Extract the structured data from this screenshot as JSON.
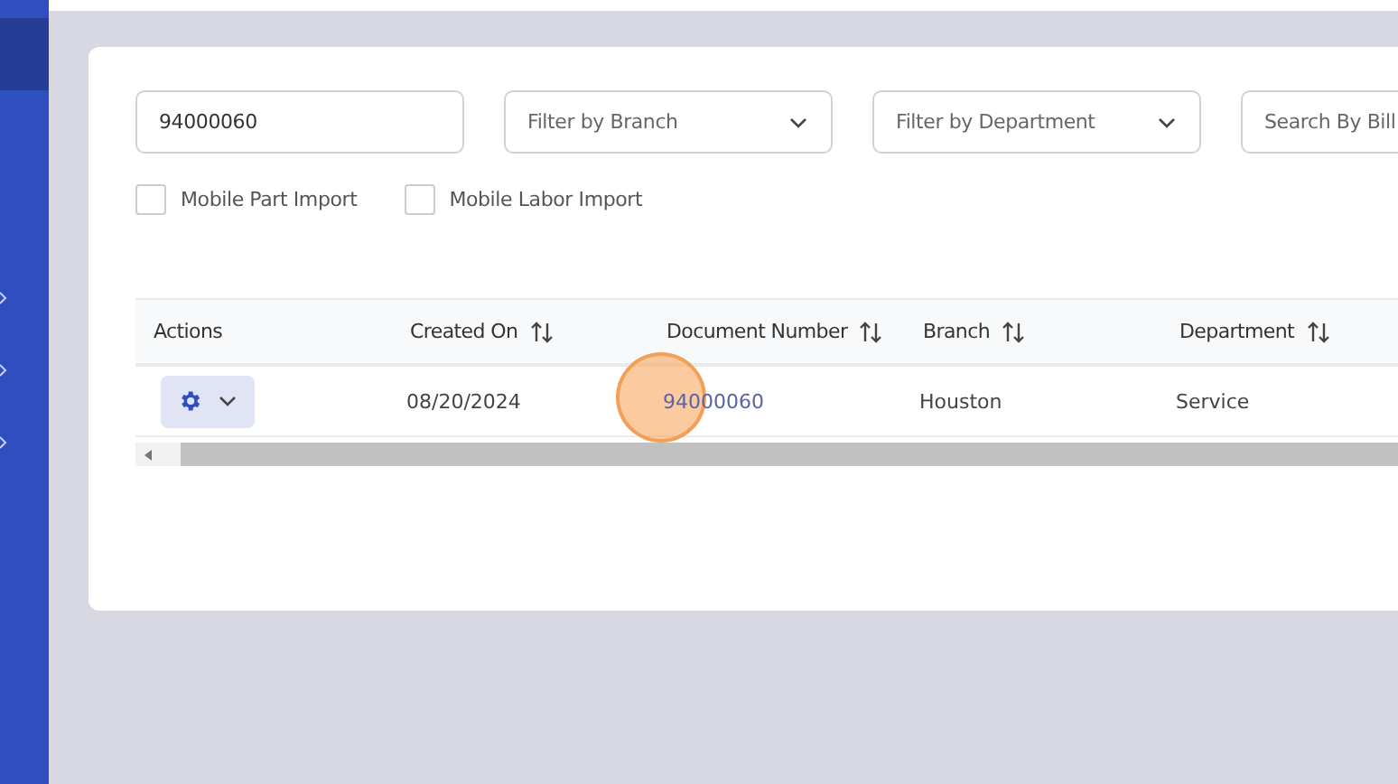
{
  "sidebar": {
    "items": [
      {
        "selected": true
      },
      {
        "selected": false
      },
      {
        "selected": false
      },
      {
        "selected": false
      }
    ]
  },
  "filters": {
    "search": {
      "value": "94000060"
    },
    "branch": {
      "placeholder": "Filter by Branch"
    },
    "department": {
      "placeholder": "Filter by Department"
    },
    "bill_search": {
      "placeholder": "Search By Bill"
    }
  },
  "checkboxes": [
    {
      "label": "Mobile Part Import",
      "checked": false
    },
    {
      "label": "Mobile Labor Import",
      "checked": false
    }
  ],
  "table": {
    "columns": [
      {
        "label": "Actions",
        "sortable": false
      },
      {
        "label": "Created On",
        "sortable": true
      },
      {
        "label": "Document Number",
        "sortable": true
      },
      {
        "label": "Branch",
        "sortable": true
      },
      {
        "label": "Department",
        "sortable": true
      }
    ],
    "rows": [
      {
        "created_on": "08/20/2024",
        "document_number": "94000060",
        "branch": "Houston",
        "department": "Service"
      }
    ]
  }
}
